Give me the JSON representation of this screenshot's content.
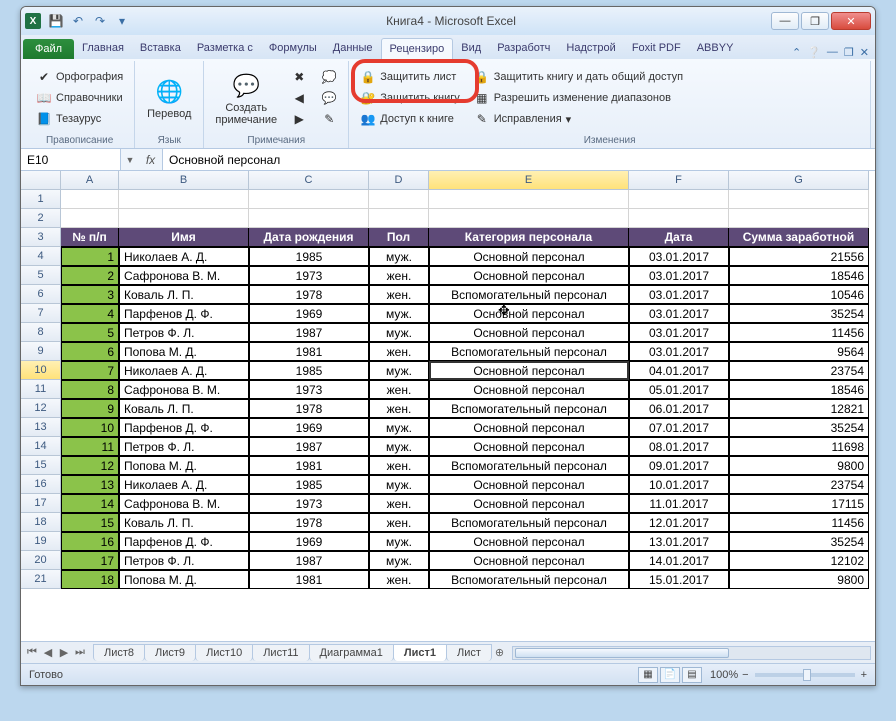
{
  "window": {
    "title": "Книга4  -  Microsoft Excel",
    "qat": {
      "save": "💾",
      "undo": "↶",
      "redo": "↷"
    },
    "buttons": {
      "min": "—",
      "max": "❐",
      "close": "✕"
    }
  },
  "tabs": {
    "file": "Файл",
    "items": [
      "Главная",
      "Вставка",
      "Разметка с",
      "Формулы",
      "Данные",
      "Рецензиро",
      "Вид",
      "Разработч",
      "Надстрой",
      "Foxit PDF",
      "ABBYY"
    ],
    "active_index": 5
  },
  "ribbon": {
    "group1": {
      "label": "Правописание",
      "spelling": "Орфография",
      "reference": "Справочники",
      "thesaurus": "Тезаурус"
    },
    "group2": {
      "label": "Язык",
      "translate": "Перевод"
    },
    "group3": {
      "label": "Примечания",
      "new_comment": "Создать примечание"
    },
    "group4": {
      "label": "Изменения",
      "protect_sheet": "Защитить лист",
      "protect_book": "Защитить книгу",
      "share_book": "Доступ к книге",
      "protect_share": "Защитить книгу и дать общий доступ",
      "allow_ranges": "Разрешить изменение диапазонов",
      "track_changes": "Исправления"
    }
  },
  "formula_bar": {
    "name_box": "E10",
    "fx": "fx",
    "formula": "Основной персонал"
  },
  "columns": [
    "A",
    "B",
    "C",
    "D",
    "E",
    "F",
    "G"
  ],
  "active_col": "E",
  "active_row": 10,
  "headers": [
    "№ п/п",
    "Имя",
    "Дата рождения",
    "Пол",
    "Категория персонала",
    "Дата",
    "Сумма заработной"
  ],
  "rows": [
    {
      "n": 4,
      "id": 1,
      "name": "Николаев А. Д.",
      "dob": 1985,
      "sex": "муж.",
      "cat": "Основной персонал",
      "date": "03.01.2017",
      "sum": 21556
    },
    {
      "n": 5,
      "id": 2,
      "name": "Сафронова В. М.",
      "dob": 1973,
      "sex": "жен.",
      "cat": "Основной персонал",
      "date": "03.01.2017",
      "sum": 18546
    },
    {
      "n": 6,
      "id": 3,
      "name": "Коваль Л. П.",
      "dob": 1978,
      "sex": "жен.",
      "cat": "Вспомогательный персонал",
      "date": "03.01.2017",
      "sum": 10546
    },
    {
      "n": 7,
      "id": 4,
      "name": "Парфенов Д. Ф.",
      "dob": 1969,
      "sex": "муж.",
      "cat": "Основной персонал",
      "date": "03.01.2017",
      "sum": 35254
    },
    {
      "n": 8,
      "id": 5,
      "name": "Петров Ф. Л.",
      "dob": 1987,
      "sex": "муж.",
      "cat": "Основной персонал",
      "date": "03.01.2017",
      "sum": 11456
    },
    {
      "n": 9,
      "id": 6,
      "name": "Попова М. Д.",
      "dob": 1981,
      "sex": "жен.",
      "cat": "Вспомогательный персонал",
      "date": "03.01.2017",
      "sum": 9564
    },
    {
      "n": 10,
      "id": 7,
      "name": "Николаев А. Д.",
      "dob": 1985,
      "sex": "муж.",
      "cat": "Основной персонал",
      "date": "04.01.2017",
      "sum": 23754
    },
    {
      "n": 11,
      "id": 8,
      "name": "Сафронова В. М.",
      "dob": 1973,
      "sex": "жен.",
      "cat": "Основной персонал",
      "date": "05.01.2017",
      "sum": 18546
    },
    {
      "n": 12,
      "id": 9,
      "name": "Коваль Л. П.",
      "dob": 1978,
      "sex": "жен.",
      "cat": "Вспомогательный персонал",
      "date": "06.01.2017",
      "sum": 12821
    },
    {
      "n": 13,
      "id": 10,
      "name": "Парфенов Д. Ф.",
      "dob": 1969,
      "sex": "муж.",
      "cat": "Основной персонал",
      "date": "07.01.2017",
      "sum": 35254
    },
    {
      "n": 14,
      "id": 11,
      "name": "Петров Ф. Л.",
      "dob": 1987,
      "sex": "муж.",
      "cat": "Основной персонал",
      "date": "08.01.2017",
      "sum": 11698
    },
    {
      "n": 15,
      "id": 12,
      "name": "Попова М. Д.",
      "dob": 1981,
      "sex": "жен.",
      "cat": "Вспомогательный персонал",
      "date": "09.01.2017",
      "sum": 9800
    },
    {
      "n": 16,
      "id": 13,
      "name": "Николаев А. Д.",
      "dob": 1985,
      "sex": "муж.",
      "cat": "Основной персонал",
      "date": "10.01.2017",
      "sum": 23754
    },
    {
      "n": 17,
      "id": 14,
      "name": "Сафронова В. М.",
      "dob": 1973,
      "sex": "жен.",
      "cat": "Основной персонал",
      "date": "11.01.2017",
      "sum": 17115
    },
    {
      "n": 18,
      "id": 15,
      "name": "Коваль Л. П.",
      "dob": 1978,
      "sex": "жен.",
      "cat": "Вспомогательный персонал",
      "date": "12.01.2017",
      "sum": 11456
    },
    {
      "n": 19,
      "id": 16,
      "name": "Парфенов Д. Ф.",
      "dob": 1969,
      "sex": "муж.",
      "cat": "Основной персонал",
      "date": "13.01.2017",
      "sum": 35254
    },
    {
      "n": 20,
      "id": 17,
      "name": "Петров Ф. Л.",
      "dob": 1987,
      "sex": "муж.",
      "cat": "Основной персонал",
      "date": "14.01.2017",
      "sum": 12102
    },
    {
      "n": 21,
      "id": 18,
      "name": "Попова М. Д.",
      "dob": 1981,
      "sex": "жен.",
      "cat": "Вспомогательный персонал",
      "date": "15.01.2017",
      "sum": 9800
    }
  ],
  "sheets": {
    "items": [
      "Лист8",
      "Лист9",
      "Лист10",
      "Лист11",
      "Диаграмма1",
      "Лист1",
      "Лист"
    ],
    "active_index": 5
  },
  "status": {
    "ready": "Готово",
    "zoom": "100%"
  }
}
